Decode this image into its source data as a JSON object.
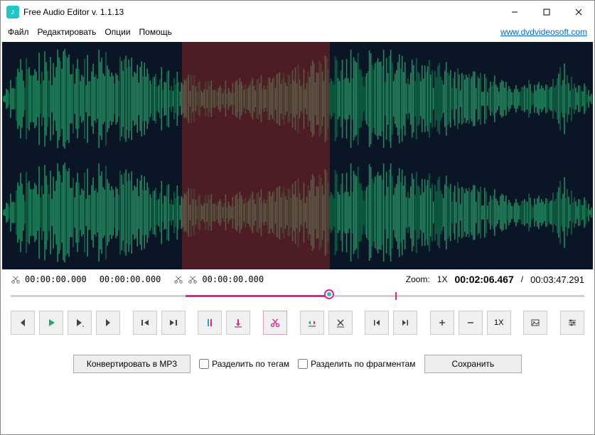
{
  "window": {
    "title": "Free Audio Editor v. 1.1.13",
    "icon_glyph": "♪"
  },
  "menu": {
    "file": "Файл",
    "edit": "Редактировать",
    "options": "Опции",
    "help": "Помощь",
    "link": "www.dvdvideosoft.com"
  },
  "waveform": {
    "selection_start_pct": 30.5,
    "selection_end_pct": 55.5
  },
  "times": {
    "sel_start": "00:00:00.000",
    "sel_end": "00:00:00.000",
    "cut_time": "00:00:00.000",
    "zoom_label": "Zoom:",
    "zoom_value": "1X",
    "position": "00:02:06.467",
    "separator": "/",
    "duration": "00:03:47.291"
  },
  "seek": {
    "sel_start_pct": 30.5,
    "sel_end_pct": 55.5,
    "cursor_pct": 67
  },
  "toolbar": {
    "zoom_reset": "1X"
  },
  "bottom": {
    "convert": "Конвертировать в MP3",
    "split_tags": "Разделить по тегам",
    "split_fragments": "Разделить по фрагментам",
    "save": "Сохранить"
  }
}
